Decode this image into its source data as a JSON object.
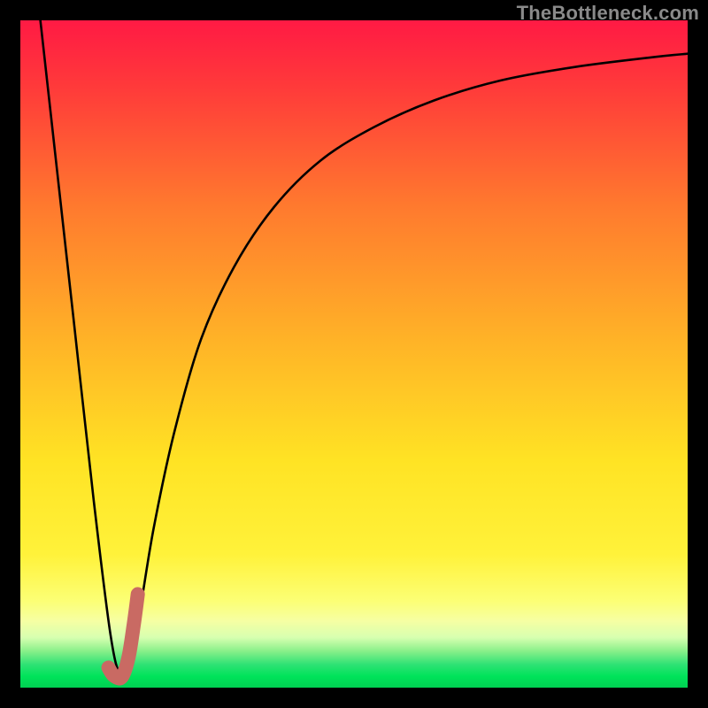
{
  "watermark": "TheBottleneck.com",
  "chart_data": {
    "type": "line",
    "title": "",
    "xlabel": "",
    "ylabel": "",
    "xlim": [
      0,
      100
    ],
    "ylim": [
      0,
      100
    ],
    "grid": false,
    "legend": false,
    "series": [
      {
        "name": "curve",
        "x": [
          3,
          5,
          8,
          11,
          13.5,
          15,
          16.5,
          18,
          20,
          23,
          27,
          32,
          38,
          45,
          53,
          62,
          72,
          83,
          95,
          100
        ],
        "y": [
          100,
          82,
          55,
          28,
          8,
          2,
          4,
          12,
          24,
          38,
          52,
          63,
          72,
          79,
          84,
          88,
          91,
          93,
          94.5,
          95
        ]
      }
    ],
    "highlight_segment": {
      "name": "salmon-stroke",
      "color": "#c96a63",
      "x": [
        13.2,
        14.0,
        15.2,
        16.2,
        17.0,
        17.6
      ],
      "y": [
        3.0,
        1.8,
        1.6,
        4.5,
        9.5,
        14.0
      ]
    },
    "background_gradient": {
      "top": "#ff1a3f",
      "mid1": "#ff8a2a",
      "mid2": "#ffe324",
      "band": "#fdff87",
      "green": "#00e35a",
      "bottom_edge": "#00c24b"
    }
  }
}
